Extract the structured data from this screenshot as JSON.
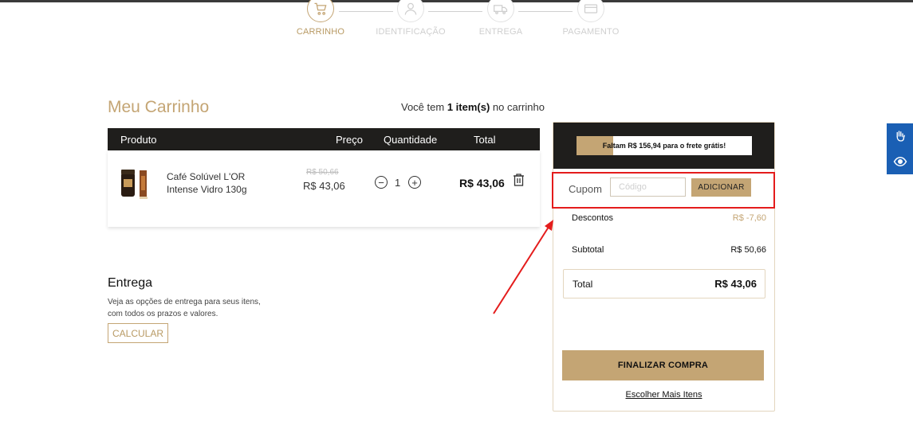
{
  "stepper": {
    "steps": [
      {
        "label": "CARRINHO",
        "icon": "cart-icon",
        "active": true
      },
      {
        "label": "IDENTIFICAÇÃO",
        "icon": "user-icon",
        "active": false
      },
      {
        "label": "ENTREGA",
        "icon": "truck-icon",
        "active": false
      },
      {
        "label": "PAGAMENTO",
        "icon": "card-icon",
        "active": false
      }
    ]
  },
  "cart": {
    "title": "Meu Carrinho",
    "count_prefix": "Você tem",
    "count_value": "1 item(s)",
    "count_suffix": "no carrinho",
    "columns": [
      "Produto",
      "Preço",
      "Quantidade",
      "Total"
    ],
    "items": [
      {
        "name": "Café Solúvel L'OR Intense Vidro 130g",
        "old_price": "R$ 50,66",
        "price": "R$ 43,06",
        "quantity": "1",
        "total": "R$ 43,06",
        "minus": "−",
        "plus": "+"
      }
    ]
  },
  "delivery": {
    "title": "Entrega",
    "text": "Veja as opções de entrega para seus itens, com todos os prazos e valores.",
    "button": "CALCULAR"
  },
  "summary": {
    "free_shipping_text": "Faltam R$ 156,94 para o frete grátis!",
    "free_shipping_progress": 0.21,
    "coupon_label": "Cupom",
    "coupon_placeholder": "Código",
    "coupon_button": "ADICIONAR",
    "discount_label": "Descontos",
    "discount_value": "R$ -7,60",
    "subtotal_label": "Subtotal",
    "subtotal_value": "R$ 50,66",
    "total_label": "Total",
    "total_value": "R$ 43,06",
    "checkout_button": "FINALIZAR COMPRA",
    "more_items_link": "Escolher Mais Itens"
  },
  "colors": {
    "accent": "#c4a574",
    "dark": "#1f1e1c",
    "annotation": "#e41c1c",
    "a11y": "#1a5fb4"
  },
  "accessibility": {
    "icons": [
      "sign-language-icon",
      "eye-icon"
    ]
  }
}
